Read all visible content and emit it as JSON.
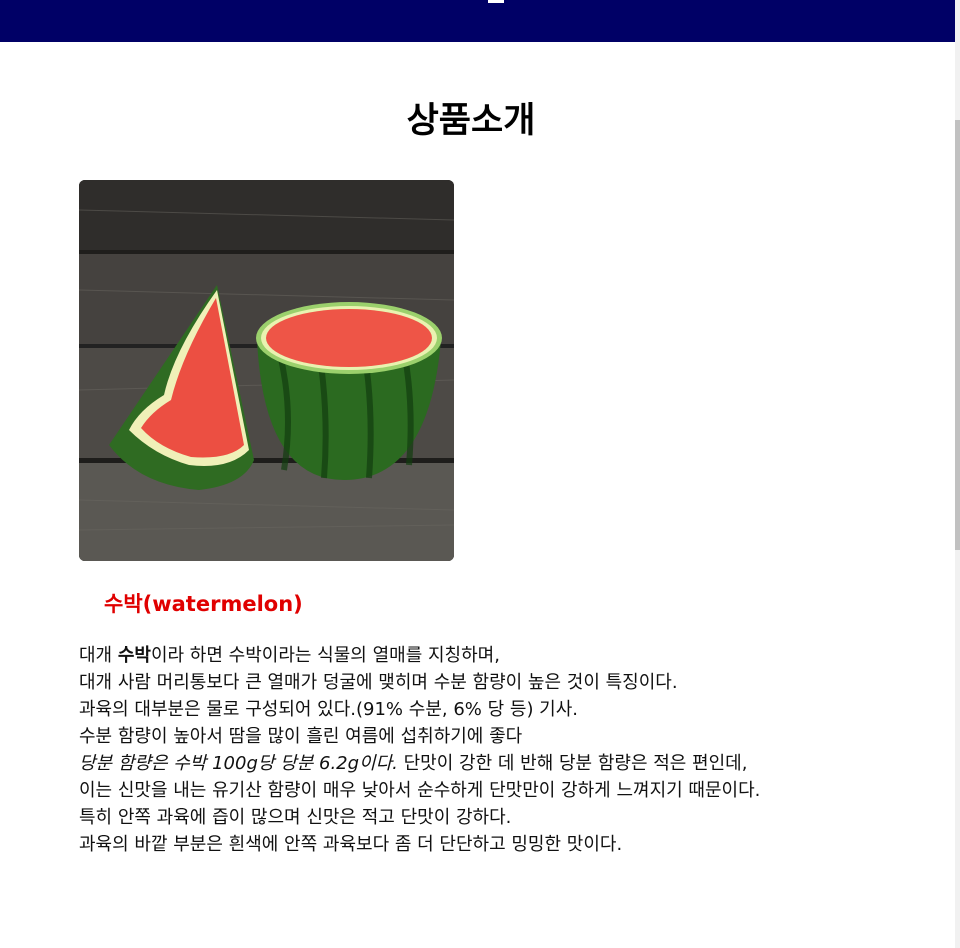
{
  "header": {
    "background": "#000066"
  },
  "page_title": "상품소개",
  "product": {
    "image_description_icon": "watermelon-image",
    "name": "수박(watermelon)",
    "name_color": "#e00000",
    "description": {
      "line1_prefix": "대개 ",
      "line1_bold": "수박",
      "line1_suffix": "이라 하면 수박이라는 식물의 열매를 지칭하며,",
      "line2": "대개 사람 머리통보다 큰 열매가 덩굴에 맺히며 수분 함량이 높은 것이 특징이다.",
      "line3": "과육의 대부분은 물로 구성되어 있다.(91% 수분, 6% 당 등) 기사.",
      "line4": "수분 함량이 높아서 땀을 많이 흘린 여름에 섭취하기에 좋다",
      "line5_italic": "당분 함량은 수박 100g당 당분 6.2g이다.",
      "line5_suffix": " 단맛이 강한 데 반해 당분 함량은 적은 편인데,",
      "line6": "이는 신맛을 내는 유기산 함량이 매우 낮아서 순수하게 단맛만이 강하게 느껴지기 때문이다.",
      "line7": "특히 안쪽 과육에 즙이 많으며 신맛은 적고 단맛이 강하다.",
      "line8": "과육의 바깥 부분은 흰색에 안쪽 과육보다 좀 더 단단하고 밍밍한 맛이다."
    }
  }
}
